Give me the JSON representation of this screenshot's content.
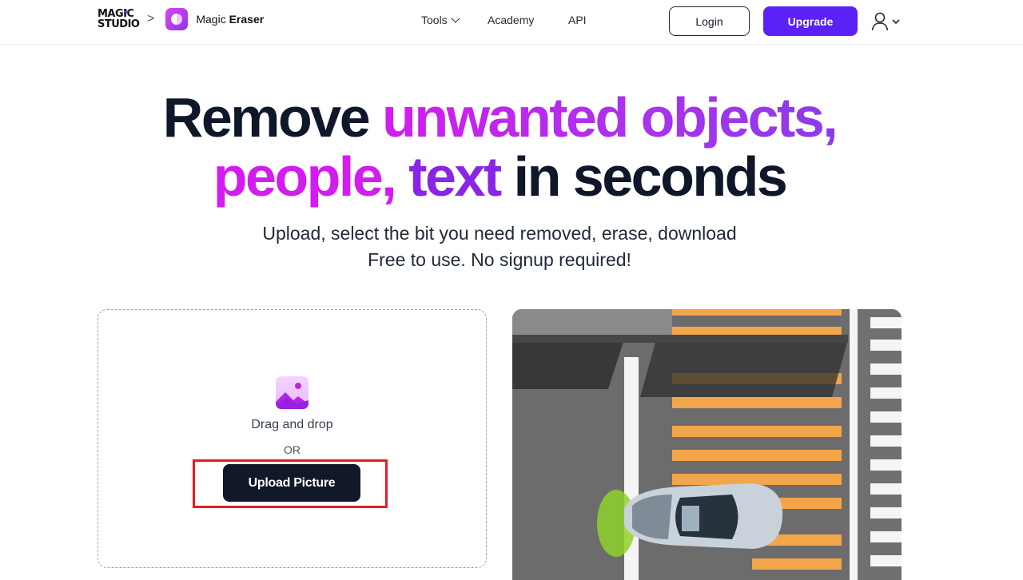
{
  "brand": {
    "logo_line1": "MAGIC",
    "logo_line2": "STUDIO",
    "breadcrumb_separator": ">",
    "app_name_prefix": "Magic",
    "app_name_bold": "Eraser"
  },
  "nav": {
    "items": [
      {
        "label": "Tools",
        "has_dropdown": true
      },
      {
        "label": "Academy"
      },
      {
        "label": "API"
      }
    ]
  },
  "header_actions": {
    "login_label": "Login",
    "upgrade_label": "Upgrade",
    "user_icon": "user-icon"
  },
  "hero": {
    "title_part1": "Remove ",
    "title_highlight1": "unwanted objects,",
    "title_highlight2": "people,",
    "title_highlight3": "text",
    "title_part2": " in seconds",
    "subtitle_line1": "Upload, select the bit you need removed, erase, download",
    "subtitle_line2": "Free to use. No signup required!"
  },
  "upload": {
    "icon": "picture-icon",
    "drag_text": "Drag and drop",
    "or_text": "OR",
    "button_label": "Upload Picture"
  },
  "colors": {
    "accent": "#5b21f6",
    "highlight_magenta": "#d21cf0",
    "highlight_purple": "#8a24e6",
    "dark": "#111827",
    "annotation_red": "#e11d24"
  }
}
